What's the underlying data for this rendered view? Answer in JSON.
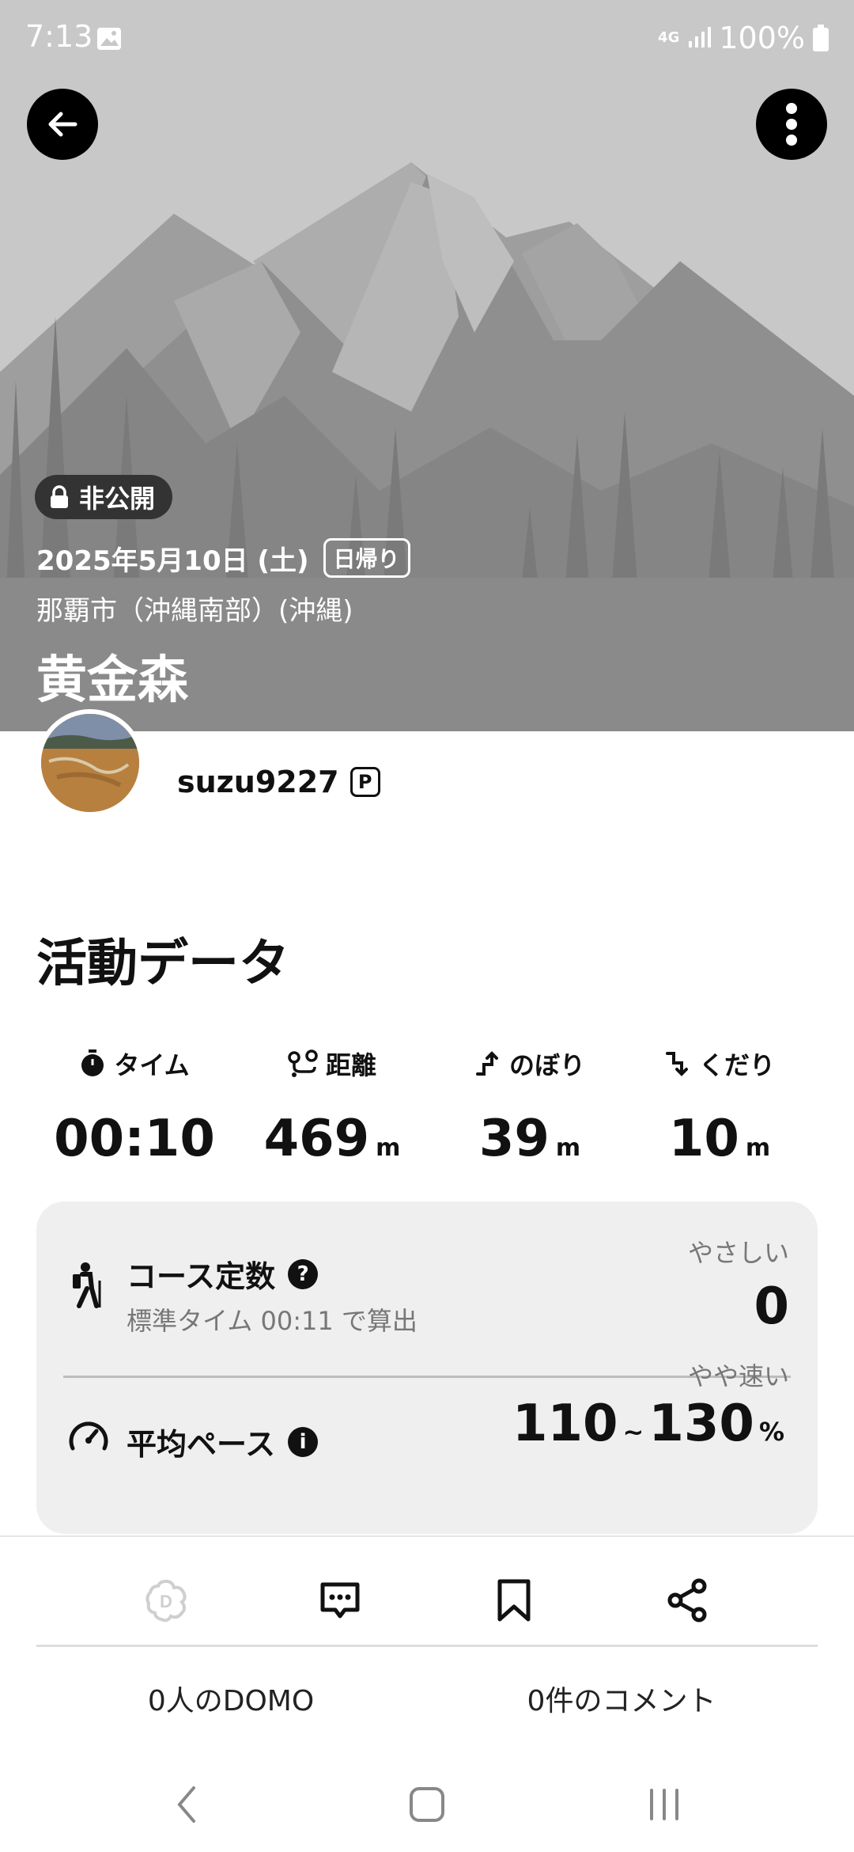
{
  "status_bar": {
    "time": "7:13",
    "network": "4G",
    "battery": "100%"
  },
  "hero": {
    "visibility": "非公開",
    "date": "2025年5月10日 (土)",
    "trip_type": "日帰り",
    "location": "那覇市（沖縄南部）(沖縄)",
    "title": "黄金森"
  },
  "user": {
    "username": "suzu9227",
    "premium_badge": "P"
  },
  "activity": {
    "section_title": "活動データ",
    "stats": [
      {
        "icon": "stopwatch-icon",
        "label": "タイム",
        "value": "00:10",
        "unit": ""
      },
      {
        "icon": "route-distance-icon",
        "label": "距離",
        "value": "469",
        "unit": "m"
      },
      {
        "icon": "ascent-icon",
        "label": "のぼり",
        "value": "39",
        "unit": "m"
      },
      {
        "icon": "descent-icon",
        "label": "くだり",
        "value": "10",
        "unit": "m"
      }
    ],
    "course": {
      "title": "コース定数",
      "subtitle": "標準タイム 00:11 で算出",
      "difficulty_label": "やさしい",
      "value": "0"
    },
    "pace": {
      "title": "平均ペース",
      "speed_label": "やや速い",
      "min": "110",
      "separator": "~",
      "max": "130",
      "unit": "%"
    }
  },
  "actions": {
    "domo_count": "0人のDOMO",
    "comment_count": "0件のコメント"
  }
}
